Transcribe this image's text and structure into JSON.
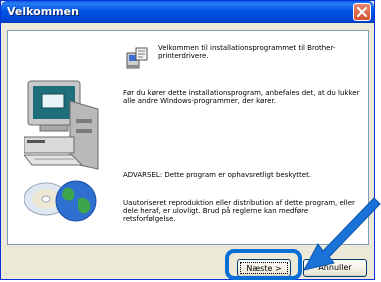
{
  "window": {
    "title": "Velkommen"
  },
  "content": {
    "welcome_text": "Velkommen til installationsprogrammet til Brother-printerdrivere.",
    "before_text": "Før du kører dette installationsprogram, anbefales det, at du lukker alle andre Windows-programmer, der kører.",
    "warning_text": "ADVARSEL: Dette program er ophavsretligt beskyttet.",
    "unauthorized_text": "Uautoriseret reproduktion eller distribution af dette program, eller dele heraf, er ulovligt.  Brud på reglerne kan medføre retsforfølgelse."
  },
  "buttons": {
    "next_label": "Næste >",
    "cancel_label": "Annuller"
  },
  "icons": {
    "close": "close-icon",
    "setup": "setup-icon",
    "computer": "computer-icon",
    "cd": "cd-disc-icon",
    "globe": "globe-icon",
    "arrow": "pointer-arrow-icon"
  },
  "colors": {
    "titlebar": "#0054e3",
    "dialog_background": "#ece9d8",
    "highlight": "#0a6fd6",
    "arrow": "#1a73d9"
  }
}
